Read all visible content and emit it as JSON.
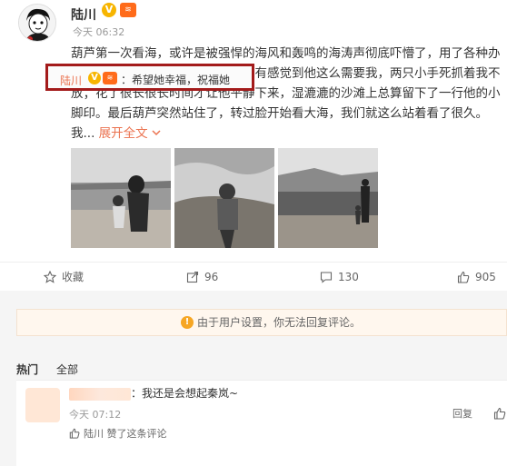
{
  "post": {
    "author": "陆川",
    "verified_mark": "V",
    "level_badge": "≋",
    "time": "今天 06:32",
    "text": "葫芦第一次看海，或许是被强悍的海风和轰鸣的海涛声彻底吓懵了，用了各种办\n法才让他肯在沙滩上行走。从来没有感觉到他这么需要我，两只小手死抓着我不\n放；花了很长很长时间才让他平静下来，湿漉漉的沙滩上总算留下了一行他的小\n脚印。最后葫芦突然站住了，转过脸开始看大海，我们就这么站着看了很久。",
    "ellipsis": "我...",
    "expand_label": "展开全文",
    "expand_icon": "chevron-down-icon",
    "photos": [
      "beach-photo-1",
      "beach-photo-2",
      "beach-photo-3"
    ]
  },
  "actions": {
    "favorite": "收藏",
    "repost": "96",
    "comment": "130",
    "like": "905"
  },
  "notice": {
    "text": "由于用户设置，你无法回复评论。",
    "icon": "warning-icon"
  },
  "tabs": {
    "hot": "热门",
    "all": "全部"
  },
  "comment": {
    "text": "：我还是会想起秦岚~",
    "time": "今天 07:12",
    "liked_by": "陆川 赞了这条评论",
    "reply_label": "回复"
  },
  "reply": {
    "name": "陆川",
    "text": "：希望她幸福，祝福她"
  },
  "colors": {
    "accent": "#eb7350",
    "highlight_border": "#a31b1b",
    "notice_bg": "#fff7ee"
  }
}
